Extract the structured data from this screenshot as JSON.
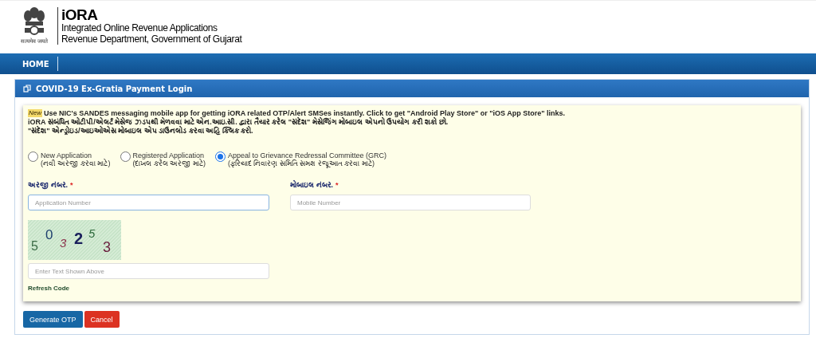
{
  "header": {
    "emblem_motto": "सत्यमेव जयते",
    "title": "iORA",
    "subtitle": "Integrated Online Revenue Applications",
    "department": "Revenue Department, Government of Gujarat"
  },
  "nav": {
    "items": [
      {
        "label": "HOME",
        "selected": true
      }
    ]
  },
  "panel": {
    "title": "COVID-19 Ex-Gratia Payment Login",
    "notice": {
      "badge": "New",
      "lines": [
        "Use NIC's SANDES messaging mobile app for getting iORA related OTP/Alert SMSes instantly. Click to get \"Android Play Store\" or \"iOS App Store\" links.",
        "iORA સંબંધિત ઓટીપી/એલર્ટ મેસેજ ઝડપથી મેળવવા માટે એન.આઇ.સી. દ્વારા તૈયાર કરેલ \"સંદેશ\" મેસેજિંગ મોબાઇલ એપનો ઉપયોગ કરી શકો છો.",
        "\"સંદેશ\" એન્ડ્રોઇડ/આઇઓએસ મોબાઇલ એપ ડાઉનલોડ કરવા અહિ ક્લિક કરો."
      ]
    },
    "options": [
      {
        "label": "New Application",
        "sublabel": "(નવી અરજી કરવા માટે)",
        "selected": false
      },
      {
        "label": "Registered Application",
        "sublabel": "(દાખલ કરેલ અરજી માટે)",
        "selected": false
      },
      {
        "label": "Appeal to Grievance Redressal Committee (GRC)",
        "sublabel": "(ફરિયાદ નિવારણ સમિતિ સમક્ષ રજૂઆત કરવા માટે)",
        "selected": true
      }
    ],
    "fields": [
      {
        "label": "અરજી નંબર.",
        "required": "*",
        "placeholder": "Application Number",
        "focused": true
      },
      {
        "label": "મોબાઇલ નંબર.",
        "required": "*",
        "placeholder": "Mobile Number",
        "focused": false
      }
    ],
    "captcha": {
      "chars": [
        {
          "text": "5",
          "color": "#3a6b45"
        },
        {
          "text": "0",
          "color": "#1e3f6e"
        },
        {
          "text": "3",
          "color": "#8a2f4a"
        },
        {
          "text": "2",
          "color": "#1a1f5c"
        },
        {
          "text": "5",
          "color": "#2f6b3e"
        },
        {
          "text": "3",
          "color": "#6a1f3e"
        }
      ],
      "placeholder": "Enter Text Shown Above",
      "refresh": "Refresh Code"
    }
  },
  "buttons": [
    {
      "label": "Generate OTP",
      "kind": "primary"
    },
    {
      "label": "Cancel",
      "kind": "danger"
    }
  ]
}
